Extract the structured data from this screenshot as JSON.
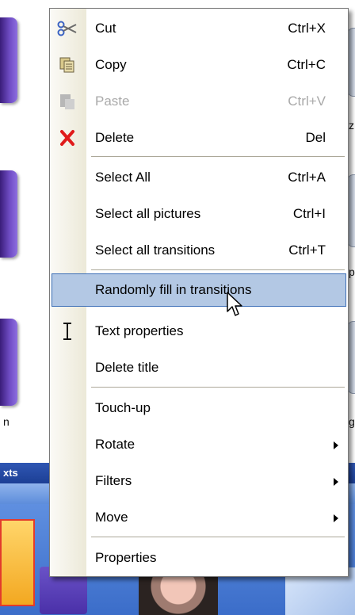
{
  "background": {
    "caption_left": "n",
    "caption_right_1": "z",
    "caption_right_2": "p",
    "caption_right_3": "g",
    "panel_label": "xts"
  },
  "menu": {
    "items": [
      {
        "label": "Cut",
        "shortcut": "Ctrl+X",
        "icon": "scissors-icon",
        "enabled": true
      },
      {
        "label": "Copy",
        "shortcut": "Ctrl+C",
        "icon": "copy-icon",
        "enabled": true
      },
      {
        "label": "Paste",
        "shortcut": "Ctrl+V",
        "icon": "paste-icon",
        "enabled": false
      },
      {
        "label": "Delete",
        "shortcut": "Del",
        "icon": "delete-x-icon",
        "enabled": true
      },
      {
        "label": "Select All",
        "shortcut": "Ctrl+A",
        "enabled": true
      },
      {
        "label": "Select all pictures",
        "shortcut": "Ctrl+I",
        "enabled": true
      },
      {
        "label": "Select all transitions",
        "shortcut": "Ctrl+T",
        "enabled": true
      },
      {
        "label": "Randomly fill in transitions",
        "shortcut": "",
        "enabled": true,
        "highlighted": true
      },
      {
        "label": "Text properties",
        "shortcut": "",
        "icon": "text-cursor-icon",
        "enabled": true
      },
      {
        "label": "Delete title",
        "shortcut": "",
        "enabled": true
      },
      {
        "label": "Touch-up",
        "shortcut": "",
        "enabled": true
      },
      {
        "label": "Rotate",
        "shortcut": "",
        "submenu": true,
        "enabled": true
      },
      {
        "label": "Filters",
        "shortcut": "",
        "submenu": true,
        "enabled": true
      },
      {
        "label": "Move",
        "shortcut": "",
        "submenu": true,
        "enabled": true
      },
      {
        "label": "Properties",
        "shortcut": "",
        "enabled": true
      }
    ]
  },
  "colors": {
    "highlight_fill": "#b3c8e4",
    "highlight_border": "#3d6fb7",
    "delete_red": "#e01b1b",
    "disabled_text": "#a9a9a9"
  }
}
